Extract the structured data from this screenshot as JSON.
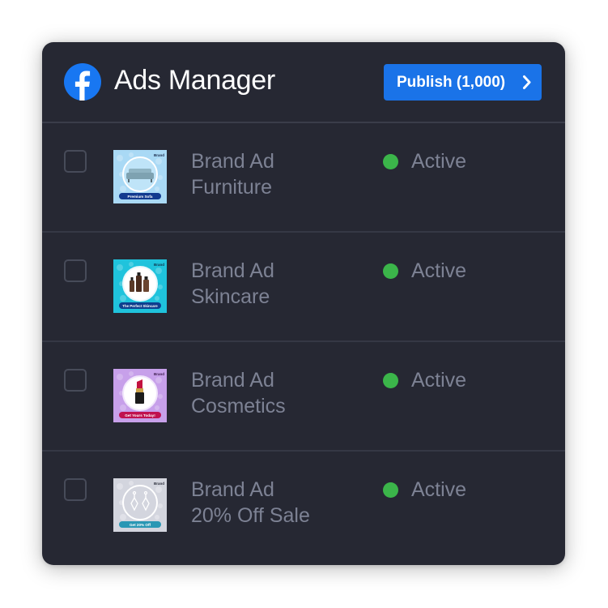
{
  "header": {
    "title": "Ads Manager",
    "publish_label": "Publish (1,000)",
    "logo_icon": "facebook-icon",
    "brand_color": "#1877f2",
    "button_color": "#1a73e8"
  },
  "ads": [
    {
      "line1": "Brand Ad",
      "line2": "Furniture",
      "status": "Active",
      "thumb": {
        "brand": "Brand",
        "caption": "Premium Sofa",
        "bg": "#a9d9f5",
        "caption_bg": "#123a8f",
        "icon": "sofa-icon"
      }
    },
    {
      "line1": "Brand Ad",
      "line2": "Skincare",
      "status": "Active",
      "thumb": {
        "brand": "Brand",
        "caption": "The Perfect Skincare",
        "bg": "#1fc3dc",
        "caption_bg": "#0f3e8e",
        "icon": "skincare-bottles-icon"
      }
    },
    {
      "line1": "Brand Ad",
      "line2": "Cosmetics",
      "status": "Active",
      "thumb": {
        "brand": "Brand",
        "caption": "Get Yours Today!",
        "bg": "#c7a0ea",
        "caption_bg": "#c0114f",
        "icon": "lipstick-icon"
      }
    },
    {
      "line1": "Brand Ad",
      "line2": "20% Off Sale",
      "status": "Active",
      "thumb": {
        "brand": "Brand",
        "caption": "Get 20% Off",
        "bg": "#d3d5de",
        "caption_bg": "#2a97b4",
        "icon": "earrings-icon"
      }
    }
  ],
  "status_color": "#3bb54a"
}
